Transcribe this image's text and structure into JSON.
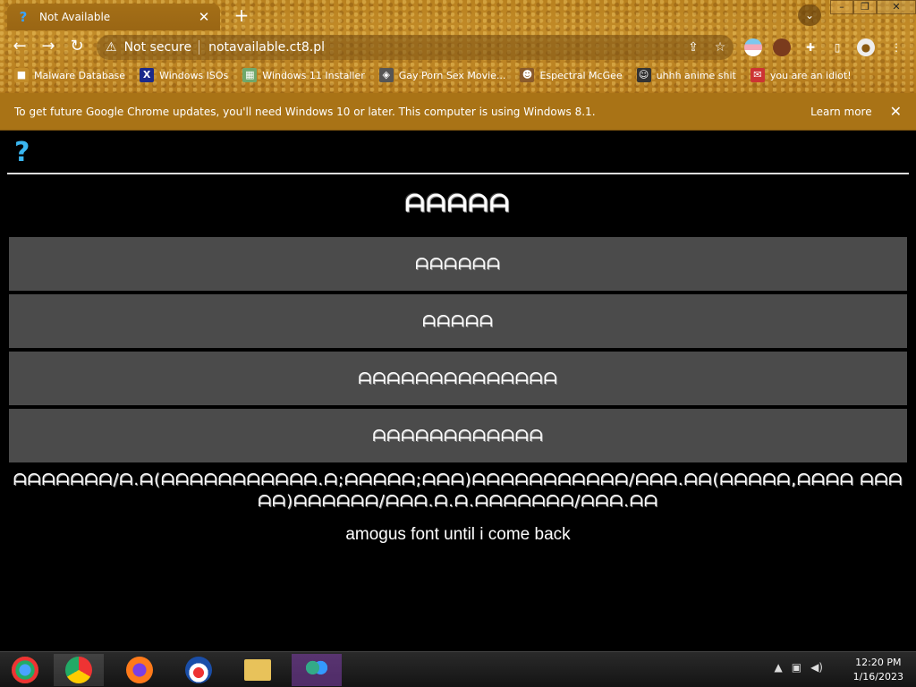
{
  "window": {
    "tab_title": "Not Available",
    "tab_favicon": "?",
    "tab_close": "✕",
    "new_tab": "+",
    "tab_search": "⌄",
    "minimize": "–",
    "restore": "❐",
    "close": "✕"
  },
  "toolbar": {
    "back": "←",
    "forward": "→",
    "reload": "↻",
    "security_icon": "⚠",
    "security_label": "Not secure",
    "url": "notavailable.ct8.pl",
    "share": "⇪",
    "bookmark_star": "☆",
    "extensions": "✚",
    "sidepanel": "▯",
    "profile": "●",
    "menu": "⋮"
  },
  "bookmarks": [
    {
      "label": "Malware Database",
      "icon": "■"
    },
    {
      "label": "Windows ISOs",
      "icon": "X"
    },
    {
      "label": "Windows 11 Installer",
      "icon": "▦"
    },
    {
      "label": "Gay Porn Sex Movie...",
      "icon": "◈"
    },
    {
      "label": "Espectral McGee",
      "icon": "☻"
    },
    {
      "label": "uhhh anime shit",
      "icon": "☺"
    },
    {
      "label": "you are an idiot!",
      "icon": "✉"
    }
  ],
  "infobar": {
    "message": "To get future Google Chrome updates, you'll need Windows 10 or later. This computer is using Windows 8.1.",
    "learn_more": "Learn more",
    "dismiss": "✕"
  },
  "page": {
    "logo": "?",
    "heading": "ᗩᗩᗩᗩᗩ",
    "buttons": [
      {
        "label": "ᗩᗩᗩᗩᗩᗩ"
      },
      {
        "label": "ᗩᗩᗩᗩᗩ"
      },
      {
        "label": "ᗩᗩᗩᗩᗩᗩᗩᗩᗩᗩᗩᗩᗩᗩ"
      },
      {
        "label": "ᗩᗩᗩᗩᗩᗩᗩᗩᗩᗩᗩᗩ"
      }
    ],
    "paragraph": "ᗩᗩᗩᗩᗩᗩᗩ/ᗩ.ᗩ(ᗩᗩᗩᗩᗩᗩᗩᗩᗩᗩᗩ.ᗩ;ᗩᗩᗩᗩᗩ;ᗩᗩᗩ)ᗩᗩᗩᗩᗩᗩᗩᗩᗩᗩᗩ/ᗩᗩᗩ.ᗩᗩ(ᗩᗩᗩᗩᗩ,ᗩᗩᗩᗩ ᗩᗩᗩᗩᗩ)ᗩᗩᗩᗩᗩᗩ/ᗩᗩᗩ.ᗩ.ᗩ.ᗩᗩᗩᗩᗩᗩᗩ/ᗩᗩᗩ.ᗩᗩ",
    "note": "amogus font until i come back"
  },
  "taskbar": {
    "time": "12:20 PM",
    "date": "1/16/2023",
    "tray_arrow": "▲",
    "tray_network": "▣",
    "tray_volume": "◀)"
  },
  "colors": {
    "chrome_frame": "#b9811f",
    "infobar": "#a97316",
    "page_bg": "#000000",
    "button_bg": "#4b4b4b",
    "logo": "#3ab6f0"
  }
}
